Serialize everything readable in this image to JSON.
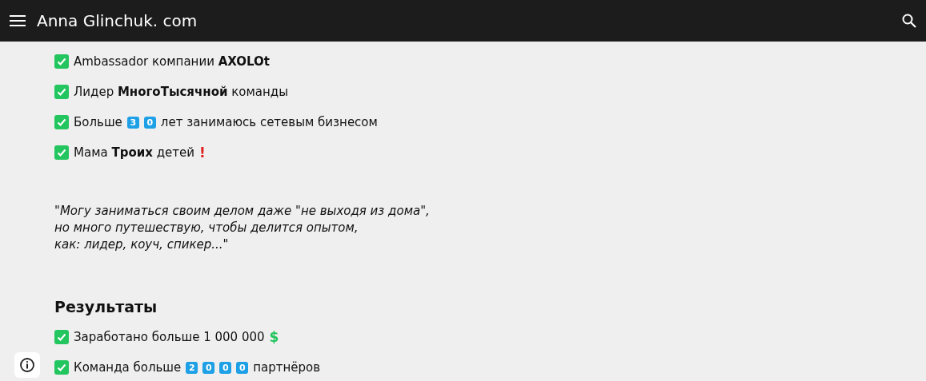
{
  "header": {
    "title": "Anna Glinchuk. com"
  },
  "facts": [
    {
      "checked": true,
      "parts": [
        {
          "kind": "text",
          "text": "Ambassador компании **AXOLOt**"
        }
      ]
    },
    {
      "checked": true,
      "parts": [
        {
          "kind": "text",
          "text": "Лидер **МногоТысячной** команды"
        }
      ]
    },
    {
      "checked": true,
      "parts": [
        {
          "kind": "text",
          "text": "Больше"
        },
        {
          "kind": "key",
          "text": "3"
        },
        {
          "kind": "key",
          "text": "0"
        },
        {
          "kind": "text",
          "text": "лет занимаюсь сетевым бизнесом"
        }
      ]
    },
    {
      "checked": true,
      "parts": [
        {
          "kind": "text",
          "text": "Мама **Троих** детей"
        },
        {
          "kind": "alert",
          "text": "!"
        }
      ]
    }
  ],
  "quote": [
    "\"Могу заниматься своим делом даже \"не выходя из дома\",",
    "но много путешествую, чтобы делится опытом,",
    "как: лидер, коуч, спикер...\""
  ],
  "results": {
    "heading": "Результаты",
    "items": [
      {
        "checked": true,
        "parts": [
          {
            "kind": "text",
            "text": "Заработано больше 1 000 000"
          },
          {
            "kind": "money",
            "text": "$"
          }
        ]
      },
      {
        "checked": true,
        "parts": [
          {
            "kind": "text",
            "text": "Команда больше"
          },
          {
            "kind": "key",
            "text": "2"
          },
          {
            "kind": "key",
            "text": "0"
          },
          {
            "kind": "key",
            "text": "0"
          },
          {
            "kind": "key",
            "text": "0"
          },
          {
            "kind": "text",
            "text": "партнёров"
          }
        ]
      }
    ]
  }
}
